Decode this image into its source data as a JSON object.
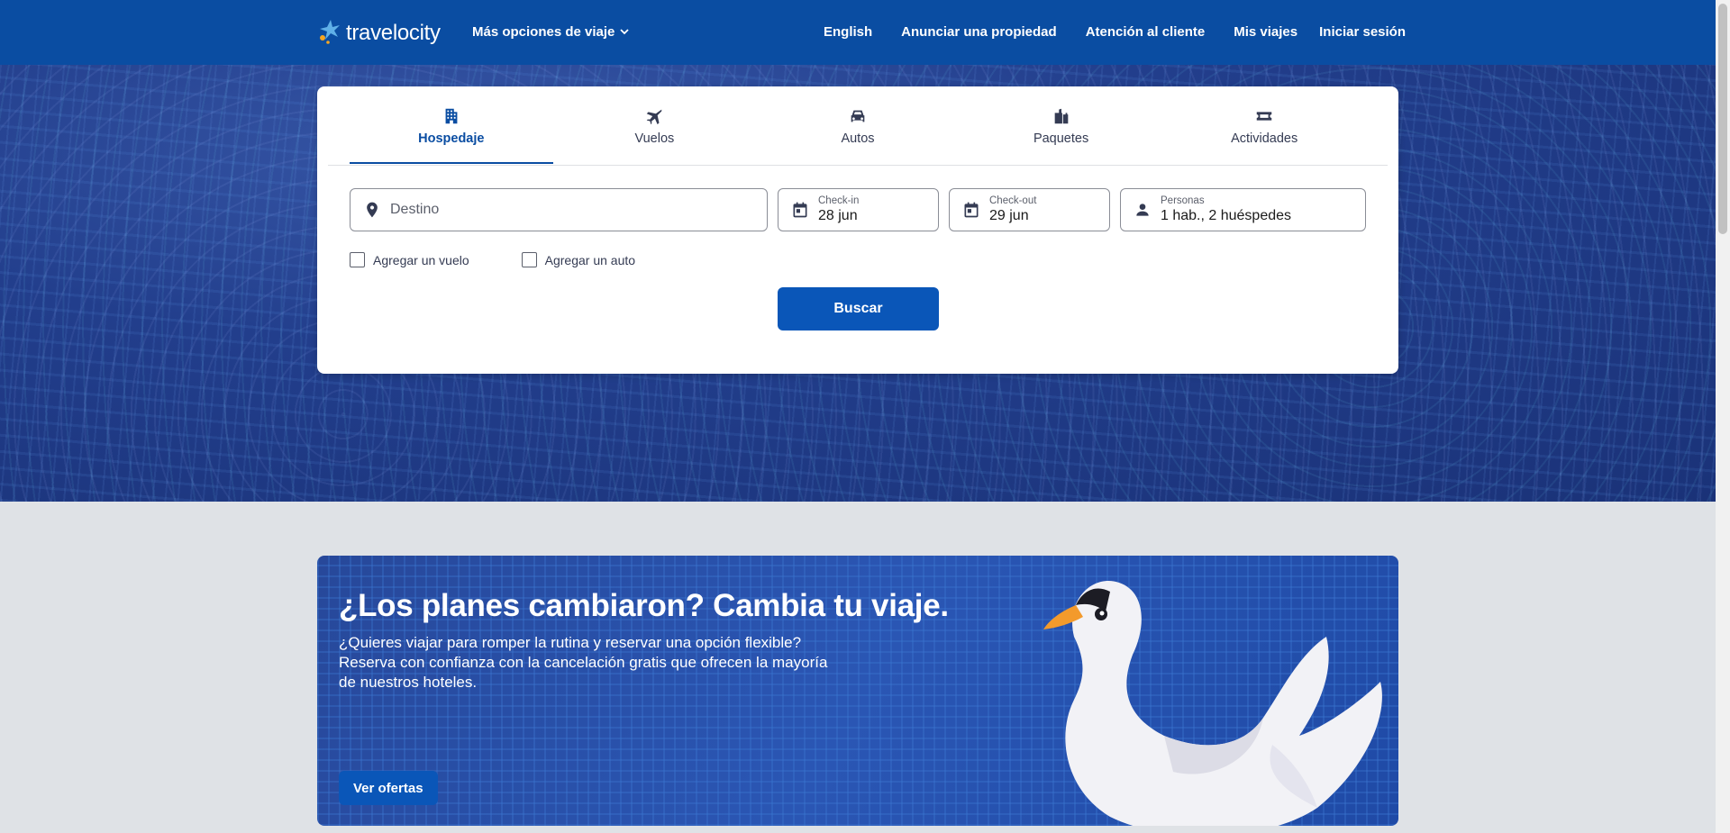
{
  "header": {
    "logo_text": "travelocity",
    "more_options": "Más opciones de viaje",
    "nav": [
      "English",
      "Anunciar una propiedad",
      "Atención al cliente",
      "Mis viajes",
      "Iniciar sesión"
    ]
  },
  "search": {
    "tabs": [
      {
        "label": "Hospedaje",
        "icon": "building-icon",
        "active": true
      },
      {
        "label": "Vuelos",
        "icon": "plane-icon",
        "active": false
      },
      {
        "label": "Autos",
        "icon": "car-icon",
        "active": false
      },
      {
        "label": "Paquetes",
        "icon": "luggage-icon",
        "active": false
      },
      {
        "label": "Actividades",
        "icon": "ticket-icon",
        "active": false
      }
    ],
    "destination_placeholder": "Destino",
    "checkin": {
      "label": "Check-in",
      "value": "28 jun"
    },
    "checkout": {
      "label": "Check-out",
      "value": "29 jun"
    },
    "guests": {
      "label": "Personas",
      "value": "1 hab., 2 huéspedes"
    },
    "add_flight": "Agregar un vuelo",
    "add_car": "Agregar un auto",
    "button": "Buscar"
  },
  "promo": {
    "title": "¿Los planes cambiaron? Cambia tu viaje.",
    "text": "¿Quieres viajar para romper la rutina y reservar una opción flexible? Reserva con confianza con la cancelación gratis que ofrecen la mayoría de nuestros hoteles.",
    "button": "Ver ofertas"
  },
  "colors": {
    "brand": "#0a4da2",
    "button": "#0a56b8"
  }
}
